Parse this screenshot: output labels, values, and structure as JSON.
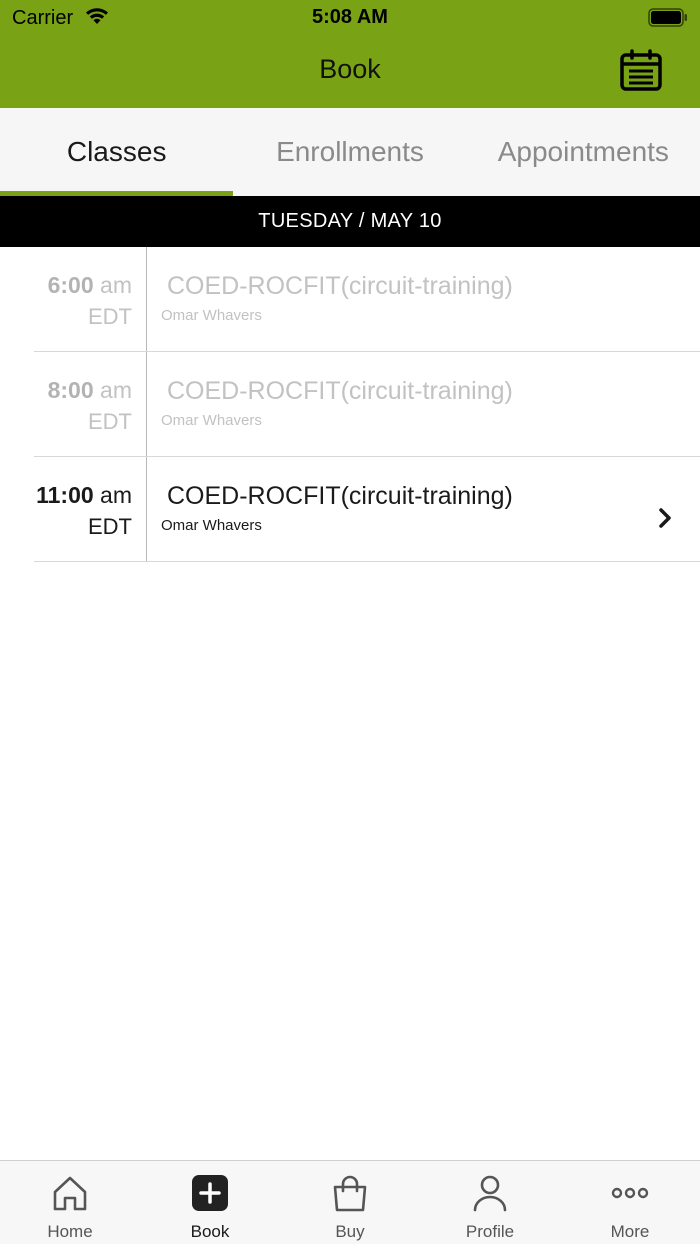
{
  "status_bar": {
    "carrier": "Carrier",
    "time": "5:08 AM"
  },
  "nav": {
    "title": "Book",
    "calendar_icon": "calendar-icon"
  },
  "tabs": [
    {
      "label": "Classes",
      "active": true
    },
    {
      "label": "Enrollments",
      "active": false
    },
    {
      "label": "Appointments",
      "active": false
    }
  ],
  "date_header": "TUESDAY / MAY 10",
  "classes": [
    {
      "time": "6:00",
      "ampm": "am",
      "tz": "EDT",
      "name": "COED-ROCFIT(circuit-training)",
      "instructor": "Omar Whavers",
      "state": "past"
    },
    {
      "time": "8:00",
      "ampm": "am",
      "tz": "EDT",
      "name": "COED-ROCFIT(circuit-training)",
      "instructor": "Omar Whavers",
      "state": "past"
    },
    {
      "time": "11:00",
      "ampm": "am",
      "tz": "EDT",
      "name": "COED-ROCFIT(circuit-training)",
      "instructor": "Omar Whavers",
      "state": "upcoming"
    }
  ],
  "bottom_tabs": [
    {
      "label": "Home",
      "icon": "home-icon"
    },
    {
      "label": "Book",
      "icon": "add-icon",
      "active": true
    },
    {
      "label": "Buy",
      "icon": "shopping-bag-icon"
    },
    {
      "label": "Profile",
      "icon": "person-icon"
    },
    {
      "label": "More",
      "icon": "more-icon"
    }
  ],
  "colors": {
    "accent": "#7aa215",
    "date_bar": "#000000"
  }
}
